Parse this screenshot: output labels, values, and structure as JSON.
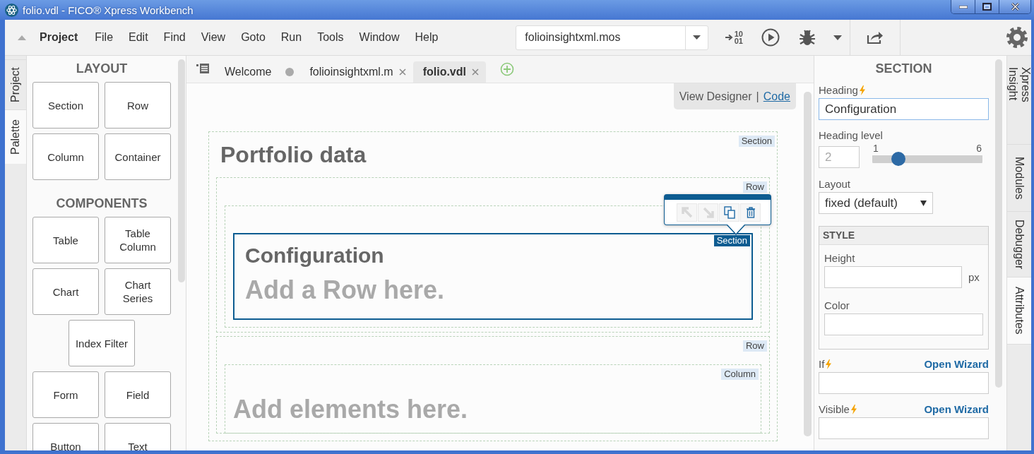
{
  "window": {
    "title": "folio.vdl - FICO® Xpress Workbench"
  },
  "menu": {
    "items": [
      {
        "label": "Project",
        "kind": "heading"
      },
      {
        "label": "File",
        "kind": "menu"
      },
      {
        "label": "Edit",
        "kind": "menu"
      },
      {
        "label": "Find",
        "kind": "menu"
      },
      {
        "label": "View",
        "kind": "menu"
      },
      {
        "label": "Goto",
        "kind": "menu"
      },
      {
        "label": "Run",
        "kind": "menu"
      },
      {
        "label": "Tools",
        "kind": "menu"
      },
      {
        "label": "Window",
        "kind": "menu"
      },
      {
        "label": "Help",
        "kind": "menu"
      }
    ]
  },
  "toolbar": {
    "run_target": {
      "value": "folioinsightxml.mos"
    },
    "compile_digits": [
      "10",
      "01"
    ]
  },
  "left_tabs": [
    {
      "label": "Project",
      "selected": false
    },
    {
      "label": "Palette",
      "selected": true
    }
  ],
  "palette": {
    "groups": [
      {
        "heading": "LAYOUT",
        "rows": [
          [
            "Section",
            "Row"
          ],
          [
            "Column",
            "Container"
          ]
        ]
      },
      {
        "heading": "COMPONENTS",
        "rows": [
          [
            "Table",
            "Table Column"
          ],
          [
            "Chart",
            "Chart Series"
          ],
          [
            "Index Filter"
          ],
          [
            "Form",
            "Field"
          ],
          [
            "Button",
            "Text"
          ]
        ]
      }
    ]
  },
  "editor_tabs": [
    {
      "label": "Welcome",
      "selected": false,
      "modified": false,
      "closable": false
    },
    {
      "label": "folioinsightxml.m",
      "selected": false,
      "modified": true,
      "closable": true
    },
    {
      "label": "folio.vdl",
      "selected": true,
      "modified": false,
      "closable": true
    }
  ],
  "view_switch": {
    "separator": "|",
    "items": [
      {
        "label": "View Designer",
        "selected": true
      },
      {
        "label": "Code",
        "selected": false
      }
    ]
  },
  "canvas": {
    "section": {
      "tag": "Section",
      "heading": "Portfolio data",
      "rows": [
        {
          "tag": "Row",
          "column": {
            "section": {
              "tag": "Section",
              "heading": "Configuration",
              "placeholder": "Add a Row here.",
              "selected": true
            }
          }
        },
        {
          "tag": "Row",
          "column": {
            "tag": "Column",
            "placeholder": "Add elements here."
          }
        }
      ]
    },
    "element_toolbar": [
      {
        "kind": "move-up",
        "disabled": true
      },
      {
        "kind": "move-down",
        "disabled": true
      },
      {
        "kind": "copy",
        "disabled": false
      },
      {
        "kind": "delete",
        "disabled": false
      }
    ]
  },
  "attributes": {
    "title": "SECTION",
    "heading": {
      "label": "Heading",
      "dynamic": true,
      "value": "Configuration"
    },
    "heading_level": {
      "label": "Heading level",
      "value": "2",
      "disabled": true,
      "min": "1",
      "max": "6",
      "level": 0.2
    },
    "layout": {
      "label": "Layout",
      "value": "fixed (default)"
    },
    "style": {
      "title": "STYLE",
      "height": {
        "label": "Height",
        "unit": "px"
      },
      "color": {
        "label": "Color"
      }
    },
    "if": {
      "label": "If",
      "dynamic": true,
      "link": "Open Wizard"
    },
    "visible": {
      "label": "Visible",
      "dynamic": true,
      "link": "Open Wizard"
    }
  },
  "right_tabs": [
    {
      "label": "Xpress Insight",
      "selected": false
    },
    {
      "label": "Modules",
      "selected": false
    },
    {
      "label": "Debugger",
      "selected": false
    },
    {
      "label": "Attributes",
      "selected": true
    }
  ]
}
